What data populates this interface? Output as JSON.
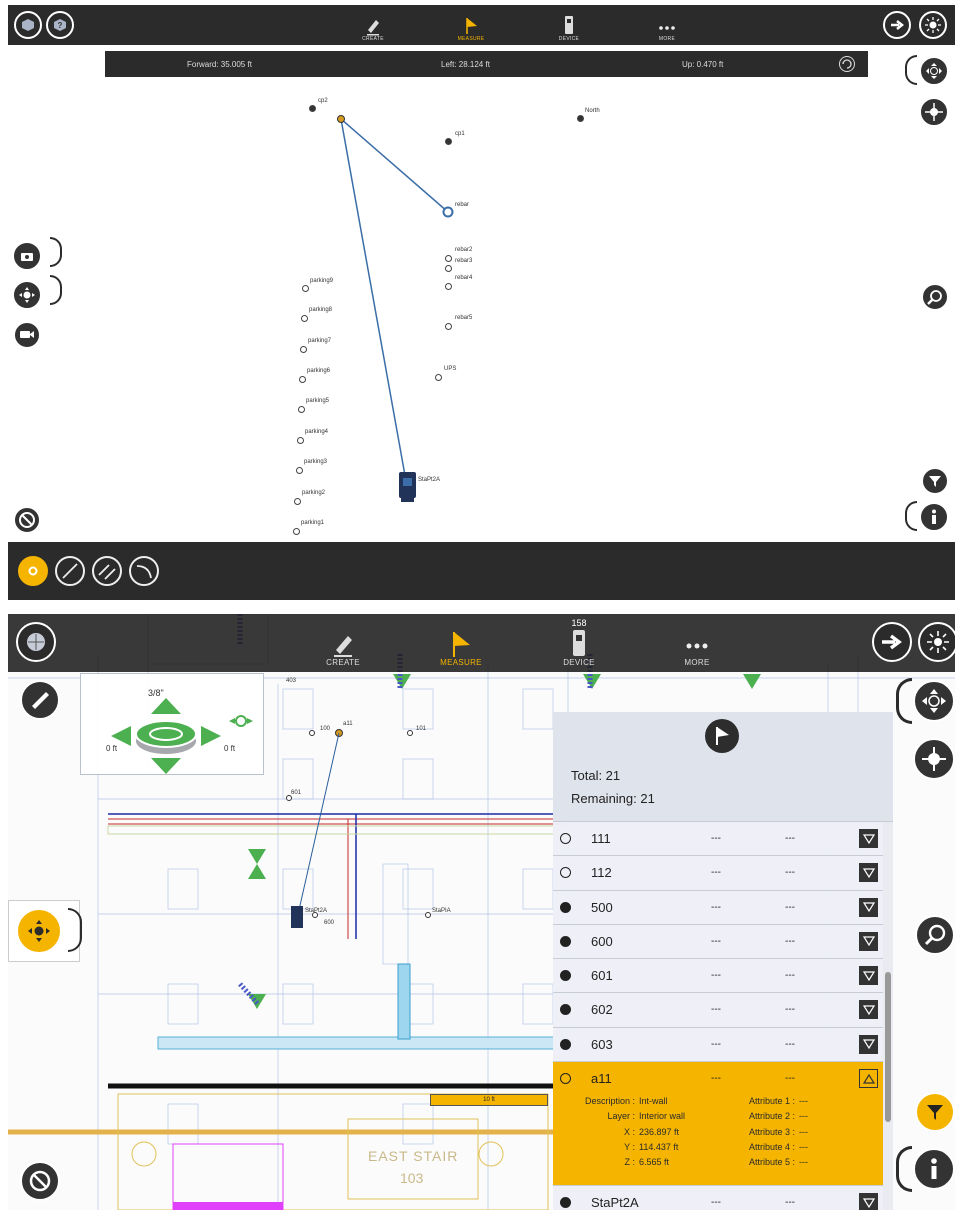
{
  "screen1": {
    "tabs": [
      {
        "label": "CREATE",
        "icon": "pencil-icon"
      },
      {
        "label": "MEASURE",
        "icon": "flag-icon",
        "active": true
      },
      {
        "label": "DEVICE",
        "icon": "total-station-icon"
      },
      {
        "label": "MORE",
        "icon": "more-dots-icon"
      }
    ],
    "info": {
      "forward": "Forward: 35.005 ft",
      "left": "Left: 28.124 ft",
      "up": "Up: 0.470 ft"
    },
    "points": {
      "cp2": "cp2",
      "north": "North",
      "cp1": "cp1",
      "rebar": "rebar",
      "rebar2": "rebar2",
      "rebar3": "rebar3",
      "rebar4": "rebar4",
      "rebar5": "rebar5",
      "ups": "UPS",
      "parking9": "parking9",
      "parking8": "parking8",
      "parking7": "parking7",
      "parking6": "parking6",
      "parking5": "parking5",
      "parking4": "parking4",
      "parking3": "parking3",
      "parking2": "parking2",
      "parking1": "parking1",
      "stapt2a": "StaPt2A"
    },
    "accent_color": "#f4b400"
  },
  "screen2": {
    "tabs": [
      {
        "label": "CREATE",
        "icon": "pencil-icon"
      },
      {
        "label": "MEASURE",
        "icon": "flag-icon",
        "active": true
      },
      {
        "label": "DEVICE",
        "icon": "total-station-icon"
      },
      {
        "label": "MORE",
        "icon": "more-dots-icon"
      }
    ],
    "device_number": "158",
    "level": {
      "top": "3/8\"",
      "left": "0 ft",
      "right": "0 ft"
    },
    "plan_labels": {
      "p100": "100",
      "a11": "a11",
      "p101": "101",
      "p601": "601",
      "p600": "600",
      "stapt2a": "StaPt2A",
      "stapia": "StaPIA",
      "p403": "403",
      "east_stair": "EAST STAIR",
      "room": "103",
      "scale": "10 ft"
    },
    "panel": {
      "total": "Total: 21",
      "remaining": "Remaining: 21",
      "rows": [
        {
          "name": "111",
          "d1": "---",
          "d2": "---",
          "icon": "open-circle-icon"
        },
        {
          "name": "112",
          "d1": "---",
          "d2": "---",
          "icon": "open-circle-icon"
        },
        {
          "name": "500",
          "d1": "---",
          "d2": "---",
          "icon": "navigation-icon"
        },
        {
          "name": "600",
          "d1": "---",
          "d2": "---",
          "icon": "navigation-icon"
        },
        {
          "name": "601",
          "d1": "---",
          "d2": "---",
          "icon": "navigation-icon"
        },
        {
          "name": "602",
          "d1": "---",
          "d2": "---",
          "icon": "navigation-icon"
        },
        {
          "name": "603",
          "d1": "---",
          "d2": "---",
          "icon": "navigation-icon"
        }
      ],
      "selected": {
        "name": "a11",
        "d1": "---",
        "d2": "---",
        "details_left": [
          {
            "k": "Description :",
            "v": "Int-wall"
          },
          {
            "k": "Layer :",
            "v": "Interior wall"
          },
          {
            "k": "X :",
            "v": "236.897 ft"
          },
          {
            "k": "Y :",
            "v": "114.437 ft"
          },
          {
            "k": "Z :",
            "v": "6.565 ft"
          }
        ],
        "details_right": [
          {
            "k": "Attribute 1 :",
            "v": "---"
          },
          {
            "k": "Attribute 2 :",
            "v": "---"
          },
          {
            "k": "Attribute 3 :",
            "v": "---"
          },
          {
            "k": "Attribute 4 :",
            "v": "---"
          },
          {
            "k": "Attribute 5 :",
            "v": "---"
          }
        ]
      },
      "last_row": {
        "name": "StaPt2A",
        "d1": "---",
        "d2": "---"
      }
    }
  }
}
